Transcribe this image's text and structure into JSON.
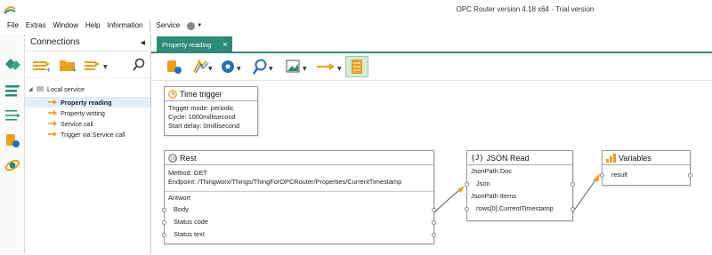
{
  "window": {
    "title": "OPC Router version 4.18 x64 - Trial version"
  },
  "menu": {
    "items": [
      "File",
      "Extras",
      "Window",
      "Help",
      "Information"
    ],
    "service_label": "Service"
  },
  "connections": {
    "title": "Connections",
    "tree": {
      "root": "Local service",
      "children": [
        "Property reading",
        "Property writing",
        "Service call",
        "Trigger via Service call"
      ]
    }
  },
  "tab": {
    "label": "Property reading",
    "close": "×"
  },
  "trigger": {
    "title": "Time trigger",
    "lines": [
      "Trigger mode: periodic",
      "Cycle: 1000millisecond",
      "Start delay: 0millisecond"
    ]
  },
  "rest": {
    "title": "Rest",
    "method": "Method: GET",
    "endpoint": "Endpoint: /Thingworx/Things/ThingForOPCRouter/Properties/CurrentTimestamp",
    "section": "Antwort",
    "ports": [
      "Body",
      "Status code",
      "Status text"
    ]
  },
  "json_read": {
    "title": "JSON Read",
    "icon_glyph": "{J}",
    "doc_label": "JsonPath Doc",
    "doc_value": "Json",
    "items_label": "JsonPath Items",
    "items_value": "rows[0].CurrentTimestamp"
  },
  "variables": {
    "title": "Variables",
    "ports": [
      "result"
    ]
  },
  "colors": {
    "accent": "#2f8a78",
    "connector": "#e8a020",
    "selection": "#e3eef7"
  }
}
